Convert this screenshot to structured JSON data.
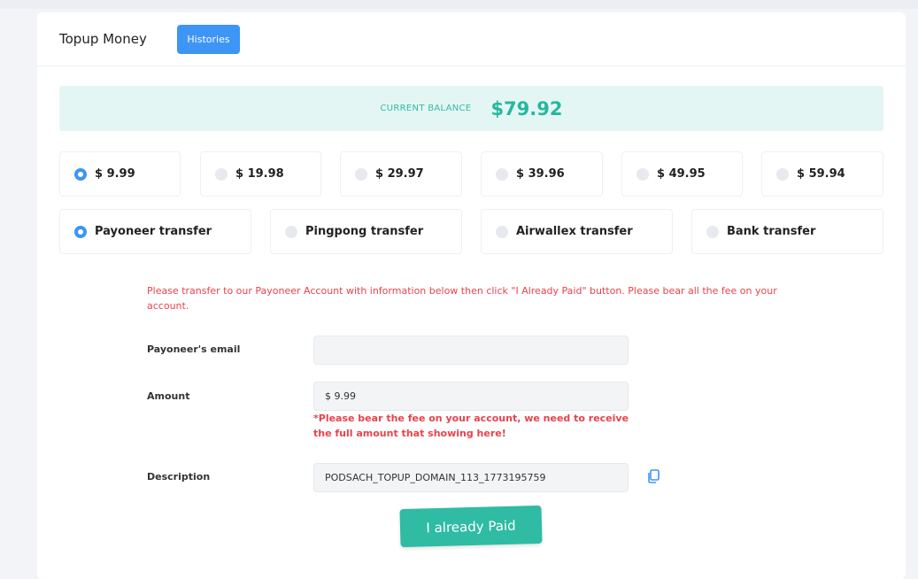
{
  "header": {
    "title": "Topup Money",
    "histories_label": "Histories"
  },
  "balance": {
    "label": "CURRENT BALANCE",
    "value": "$79.92"
  },
  "amounts": [
    {
      "label": "$ 9.99",
      "selected": true
    },
    {
      "label": "$ 19.98",
      "selected": false
    },
    {
      "label": "$ 29.97",
      "selected": false
    },
    {
      "label": "$ 39.96",
      "selected": false
    },
    {
      "label": "$ 49.95",
      "selected": false
    },
    {
      "label": "$ 59.94",
      "selected": false
    }
  ],
  "methods": [
    {
      "label": "Payoneer transfer",
      "selected": true
    },
    {
      "label": "Pingpong transfer",
      "selected": false
    },
    {
      "label": "Airwallex transfer",
      "selected": false
    },
    {
      "label": "Bank transfer",
      "selected": false
    }
  ],
  "notice": "Please transfer to our Payoneer Account with information below then click \"I Already Paid\" button. Please bear all the fee on your account.",
  "form": {
    "email_label": "Payoneer's email",
    "email_value": "",
    "amount_label": "Amount",
    "amount_value": "$ 9.99",
    "amount_warning": "*Please bear the fee on your account, we need to receive the full amount that showing here!",
    "description_label": "Description",
    "description_value": "PODSACH_TOPUP_DOMAIN_113_1773195759"
  },
  "paid_label": "I already Paid",
  "colors": {
    "primary": "#3d95f5",
    "accent": "#2fbba4",
    "danger": "#e8434b",
    "balance_bg": "#e4f6f3"
  },
  "icons": {
    "copy": "copy-icon"
  }
}
